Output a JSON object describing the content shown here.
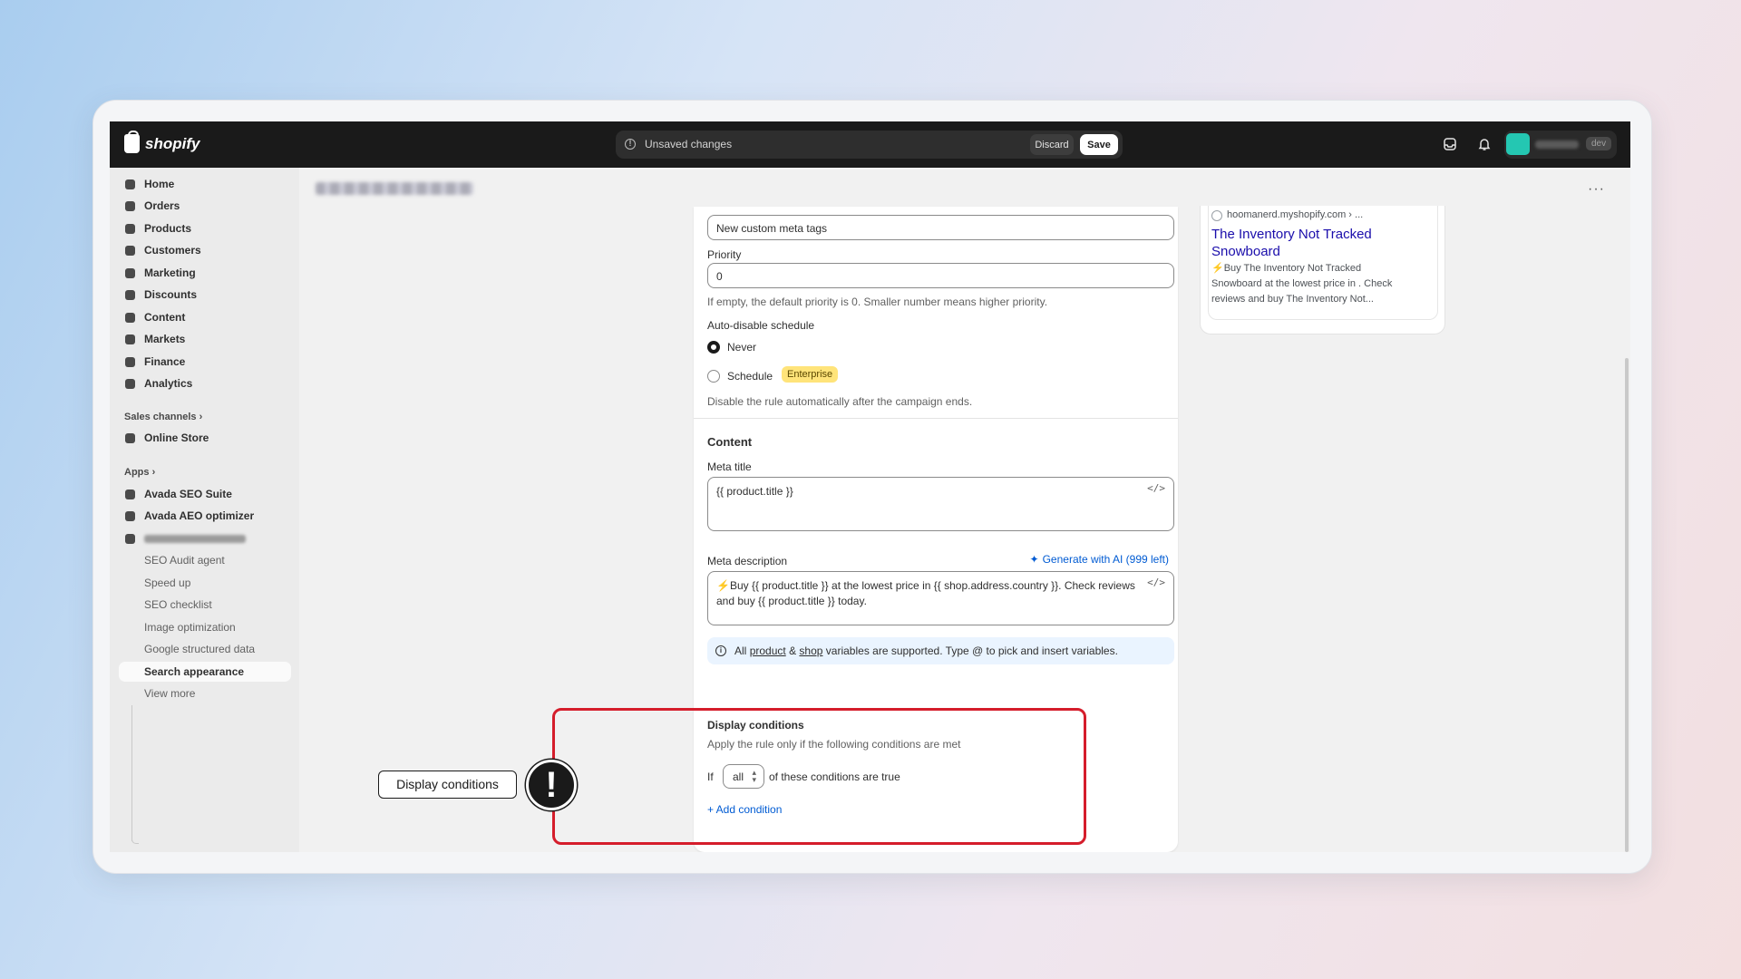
{
  "topbar": {
    "brand": "shopify",
    "unsaved_text": "Unsaved changes",
    "discard_label": "Discard",
    "save_label": "Save",
    "env_badge": "dev"
  },
  "sidebar": {
    "items": [
      {
        "label": "Home",
        "icon": "home-icon"
      },
      {
        "label": "Orders",
        "icon": "orders-icon"
      },
      {
        "label": "Products",
        "icon": "products-icon"
      },
      {
        "label": "Customers",
        "icon": "customers-icon"
      },
      {
        "label": "Marketing",
        "icon": "marketing-icon"
      },
      {
        "label": "Discounts",
        "icon": "discounts-icon"
      },
      {
        "label": "Content",
        "icon": "content-icon"
      },
      {
        "label": "Markets",
        "icon": "markets-icon"
      },
      {
        "label": "Finance",
        "icon": "finance-icon"
      },
      {
        "label": "Analytics",
        "icon": "analytics-icon"
      }
    ],
    "sales_channels_label": "Sales channels",
    "online_store_label": "Online Store",
    "apps_label": "Apps",
    "apps": [
      {
        "label": "Avada SEO Suite"
      },
      {
        "label": "Avada AEO optimizer"
      }
    ],
    "sub_items": [
      {
        "label": "SEO Audit agent"
      },
      {
        "label": "Speed up"
      },
      {
        "label": "SEO checklist"
      },
      {
        "label": "Image optimization"
      },
      {
        "label": "Google structured data"
      },
      {
        "label": "Search appearance"
      },
      {
        "label": "View more"
      }
    ]
  },
  "form": {
    "rule_name_value": "New custom meta tags",
    "priority_label": "Priority",
    "priority_value": "0",
    "priority_help": "If empty, the default priority is 0. Smaller number means higher priority.",
    "auto_disable_label": "Auto-disable schedule",
    "never_label": "Never",
    "schedule_label": "Schedule",
    "enterprise_badge": "Enterprise",
    "schedule_help": "Disable the rule automatically after the campaign ends.",
    "content_title": "Content",
    "meta_title_label": "Meta title",
    "meta_title_value": "{{ product.title }}",
    "meta_description_label": "Meta description",
    "generate_ai_label": "Generate with AI (999 left)",
    "meta_description_value": "⚡Buy {{ product.title }} at the lowest price in {{ shop.address.country }}. Check reviews and buy {{ product.title }} today.",
    "info_prefix": "All",
    "info_product": "product",
    "info_amp": "&",
    "info_shop": "shop",
    "info_suffix": "variables are supported. Type @ to pick and insert variables.",
    "display_conditions_title": "Display conditions",
    "display_conditions_help": "Apply the rule only if the following conditions are met",
    "if_label": "If",
    "match_value": "all",
    "conditions_suffix": "of these conditions are true",
    "add_condition_label": "+ Add condition"
  },
  "preview": {
    "site": "hoomanerd.myshopify.com › ...",
    "title": "The Inventory Not Tracked Snowboard",
    "description": "⚡Buy The Inventory Not Tracked Snowboard at the lowest price in . Check reviews and buy The Inventory Not..."
  },
  "annotation": {
    "callout_label": "Display conditions",
    "marker": "!",
    "highlight_color": "#d51d2b"
  }
}
